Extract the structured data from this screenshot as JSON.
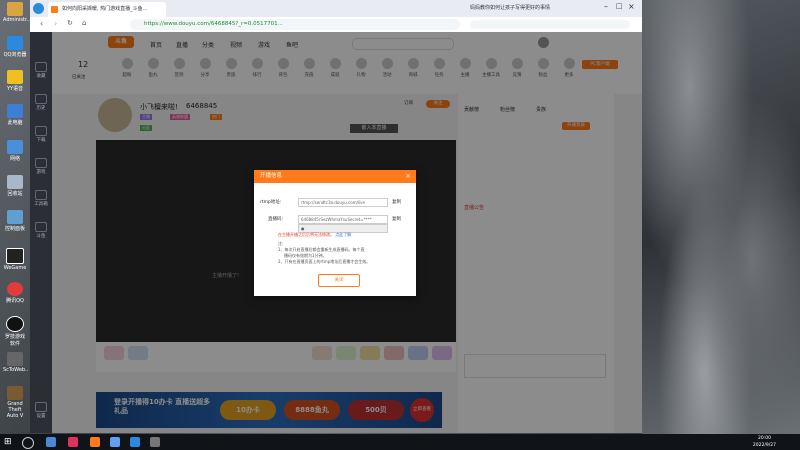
{
  "desktop": {
    "icons": [
      {
        "label": "Administr..."
      },
      {
        "label": "QQ浏览器"
      },
      {
        "label": "YY语音"
      },
      {
        "label": "此电脑"
      },
      {
        "label": "网络"
      },
      {
        "label": "回收站"
      },
      {
        "label": "控制面板"
      },
      {
        "label": "WeGame"
      },
      {
        "label": "腾讯QQ"
      },
      {
        "label": "罗技游戏软件"
      },
      {
        "label": "ScToWeb.."
      },
      {
        "label": "Grand Theft Auto V"
      }
    ]
  },
  "browser": {
    "tab_title": "如何向阳采撷暖, 热门游戏直播_斗鱼...",
    "url": "https://www.douyu.com/6468845?_r=0.0517701...",
    "right_tab_title": "妈妈教你如何让孩子写得更好的事情",
    "side_labels": [
      "收藏",
      "历史",
      "下载",
      "游戏",
      "工具箱",
      "斗鱼",
      "设置"
    ]
  },
  "page": {
    "logo": "斗鱼",
    "nav": [
      "首页",
      "直播",
      "分类",
      "视频",
      "游戏",
      "鱼吧"
    ],
    "level_number": "12",
    "level_label": "已关注",
    "icon_row": [
      "超粉",
      "鱼丸",
      "签到",
      "分享",
      "贵族",
      "排行",
      "背包",
      "充值",
      "成就",
      "礼物",
      "活动",
      "商城",
      "任务",
      "主播",
      "主播工具",
      "竞猜",
      "粉丝",
      "更多"
    ],
    "pc_client": "PC客户端",
    "streamer_name": "小飞檀来啦!",
    "room_id": "6468845",
    "tags": [
      "主播",
      "英雄联盟",
      "热门",
      "分区"
    ],
    "follow_label": "关注",
    "subscribe_label": "订阅",
    "embed_label": "嵌入本直播",
    "player_text": "主播开播了!",
    "chat": {
      "tabs": [
        "贡献榜",
        "粉丝榜",
        "贵族"
      ],
      "announcement_title": "直播公告",
      "open_label": "开通贵族"
    },
    "banner": {
      "text": "登录开播得10办卡 直播送超多礼品",
      "buttons": [
        "10办卡",
        "8888鱼丸",
        "500贝"
      ],
      "side": "立即查看"
    }
  },
  "modal": {
    "title": "开播信息",
    "close": "×",
    "rtmp_label": "rtmp地址:",
    "rtmp_value": "rtmp://sendtc3a.douyu.com/live",
    "rtmp_copy": "复制",
    "code_label": "直播码:",
    "code_value": "6468845rSezWhmaYsuSecret=****",
    "code_copy": "复制",
    "select_value": "●",
    "warning": "在主播开播之后后将无法修改。",
    "warning_link": "点此了解",
    "notes": [
      "注:",
      "1、每次开启直播后都会重新生成直播码。每个直",
      "播码仅有效期为1分钟。",
      "2、只有在直播页面上的rtmp地址后直播才会生效。"
    ],
    "ok": "关闭"
  },
  "taskbar": {
    "time": "20:00",
    "date": "2022/9/27"
  },
  "colors": {
    "accent": "#ff7a1a",
    "link": "#2a6fd6",
    "warning": "#e03b2c"
  }
}
